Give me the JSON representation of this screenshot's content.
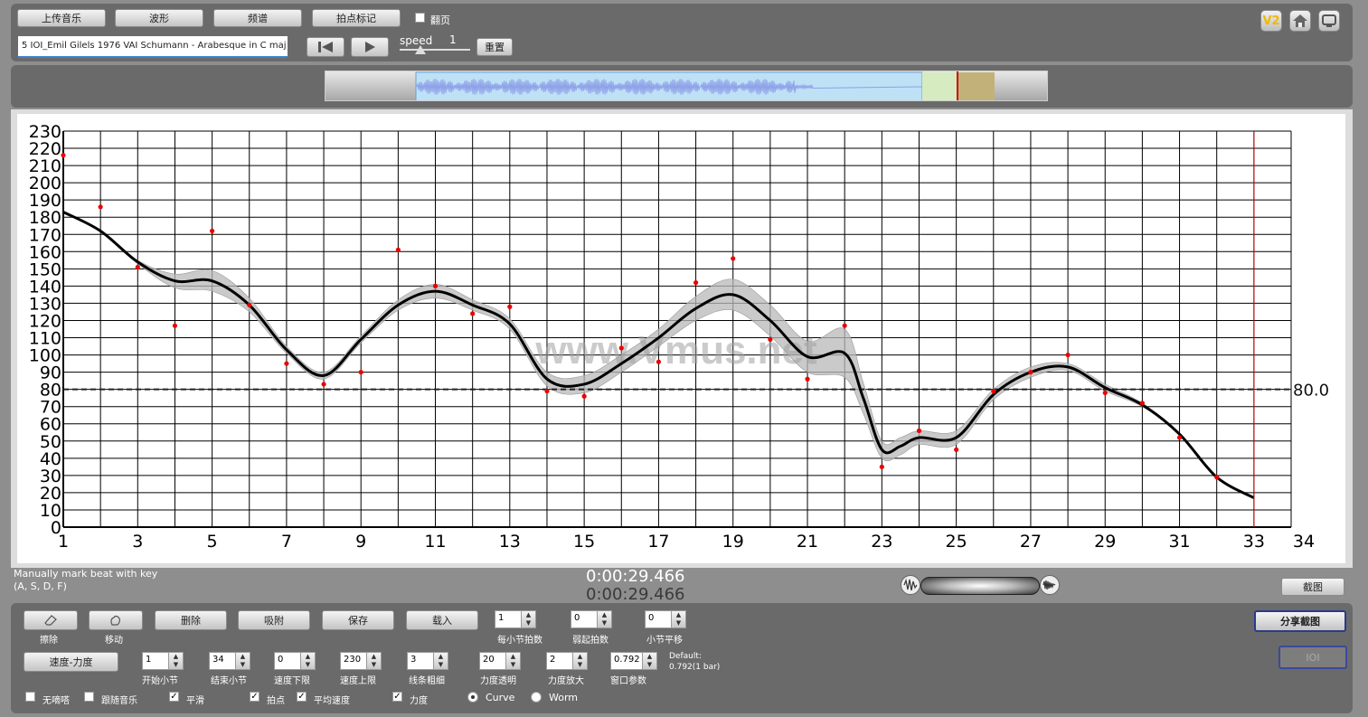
{
  "toolbar": {
    "upload_music": "上传音乐",
    "waveform": "波形",
    "spectrum": "频谱",
    "beat_mark": "拍点标记",
    "page_turn": "翻页",
    "page_turn_checked": false,
    "file_name": "5 IOI_Emil Gilels 1976 VAI Schumann - Arabesque in C maj",
    "speed_label": "speed",
    "speed_value": "1",
    "speed_level": 0.3,
    "reset": "重置"
  },
  "icons": {
    "v2": "V2",
    "home": "home-icon",
    "screen": "monitor-icon"
  },
  "hint": {
    "line1": "Manually mark beat with key",
    "line2": "(A, S, D, F)"
  },
  "time": {
    "current": "0:00:29.466",
    "total": "0:00:29.466"
  },
  "screenshot_button": "截图",
  "share_screenshot_button": "分享截图",
  "ioi_button": "IOI",
  "controls": {
    "erase": "擦除",
    "move": "移动",
    "delete": "删除",
    "snap": "吸附",
    "save": "保存",
    "load": "载入",
    "beats_per_bar": {
      "value": "1",
      "label": "每小节拍数"
    },
    "pickup_beats": {
      "value": "0",
      "label": "弱起拍数"
    },
    "bar_shift": {
      "value": "0",
      "label": "小节平移"
    },
    "tempo_dynamics": "速度-力度",
    "start_bar": {
      "value": "1",
      "label": "开始小节"
    },
    "end_bar": {
      "value": "34",
      "label": "结束小节"
    },
    "tempo_min": {
      "value": "0",
      "label": "速度下限"
    },
    "tempo_max": {
      "value": "230",
      "label": "速度上限"
    },
    "line_width": {
      "value": "3",
      "label": "线条粗细"
    },
    "dyn_transparency": {
      "value": "20",
      "label": "力度透明"
    },
    "dyn_scale": {
      "value": "2",
      "label": "力度放大"
    },
    "window_param": {
      "value": "0.792",
      "label": "窗口参数"
    },
    "default_line1": "Default:",
    "default_line2": "0.792(1 bar)"
  },
  "checkboxes": [
    {
      "label": "无嘀嗒",
      "checked": false
    },
    {
      "label": "跟随音乐",
      "checked": false
    },
    {
      "label": "平滑",
      "checked": true
    },
    {
      "label": "拍点",
      "checked": true
    },
    {
      "label": "平均速度",
      "checked": true
    },
    {
      "label": "力度",
      "checked": true
    }
  ],
  "radios": [
    {
      "label": "Curve",
      "selected": true
    },
    {
      "label": "Worm",
      "selected": false
    }
  ],
  "watermark": "www.Vmus.net",
  "colors": {
    "accent": "#cc0000",
    "points": "#ee0000",
    "band": "#bdbdbd",
    "selection": "#bfe1f6",
    "wave": "#8ea0e8"
  },
  "chart_data": {
    "type": "line",
    "ylim": [
      0,
      230
    ],
    "xlim": [
      1,
      34
    ],
    "y_ticks": [
      0,
      10,
      20,
      30,
      40,
      50,
      60,
      70,
      80,
      90,
      100,
      110,
      120,
      130,
      140,
      150,
      160,
      170,
      180,
      190,
      200,
      210,
      220,
      230
    ],
    "x_tick_labels": [
      1,
      3,
      5,
      7,
      9,
      11,
      13,
      15,
      17,
      19,
      21,
      23,
      25,
      27,
      29,
      31,
      33,
      34
    ],
    "average_tempo": 80.0,
    "average_label": "80.0",
    "cursor_x": 33,
    "beat_points": [
      {
        "x": 1,
        "y": 216
      },
      {
        "x": 2,
        "y": 186
      },
      {
        "x": 3,
        "y": 151
      },
      {
        "x": 4,
        "y": 117
      },
      {
        "x": 5,
        "y": 172
      },
      {
        "x": 6,
        "y": 129
      },
      {
        "x": 7,
        "y": 95
      },
      {
        "x": 8,
        "y": 83
      },
      {
        "x": 9,
        "y": 90
      },
      {
        "x": 10,
        "y": 161
      },
      {
        "x": 11,
        "y": 140
      },
      {
        "x": 12,
        "y": 124
      },
      {
        "x": 13,
        "y": 128
      },
      {
        "x": 14,
        "y": 79
      },
      {
        "x": 15,
        "y": 76
      },
      {
        "x": 16,
        "y": 104
      },
      {
        "x": 17,
        "y": 96
      },
      {
        "x": 18,
        "y": 142
      },
      {
        "x": 19,
        "y": 156
      },
      {
        "x": 20,
        "y": 109
      },
      {
        "x": 21,
        "y": 86
      },
      {
        "x": 22,
        "y": 117
      },
      {
        "x": 23,
        "y": 35
      },
      {
        "x": 24,
        "y": 56
      },
      {
        "x": 25,
        "y": 45
      },
      {
        "x": 26,
        "y": 79
      },
      {
        "x": 27,
        "y": 90
      },
      {
        "x": 28,
        "y": 100
      },
      {
        "x": 29,
        "y": 78
      },
      {
        "x": 30,
        "y": 72
      },
      {
        "x": 31,
        "y": 52
      },
      {
        "x": 32,
        "y": 29
      }
    ],
    "smooth_curve": [
      {
        "x": 1,
        "y": 183
      },
      {
        "x": 2,
        "y": 172
      },
      {
        "x": 3,
        "y": 154
      },
      {
        "x": 4,
        "y": 143
      },
      {
        "x": 5,
        "y": 143
      },
      {
        "x": 6,
        "y": 129
      },
      {
        "x": 7,
        "y": 103
      },
      {
        "x": 8,
        "y": 88
      },
      {
        "x": 9,
        "y": 109
      },
      {
        "x": 10,
        "y": 129
      },
      {
        "x": 11,
        "y": 137
      },
      {
        "x": 12,
        "y": 129
      },
      {
        "x": 13,
        "y": 118
      },
      {
        "x": 14,
        "y": 86
      },
      {
        "x": 15,
        "y": 83
      },
      {
        "x": 16,
        "y": 95
      },
      {
        "x": 17,
        "y": 110
      },
      {
        "x": 18,
        "y": 127
      },
      {
        "x": 19,
        "y": 135
      },
      {
        "x": 20,
        "y": 120
      },
      {
        "x": 21,
        "y": 99
      },
      {
        "x": 22,
        "y": 101
      },
      {
        "x": 22.5,
        "y": 75
      },
      {
        "x": 23,
        "y": 45
      },
      {
        "x": 23.5,
        "y": 47
      },
      {
        "x": 24,
        "y": 52
      },
      {
        "x": 25,
        "y": 52
      },
      {
        "x": 26,
        "y": 77
      },
      {
        "x": 27,
        "y": 90
      },
      {
        "x": 28,
        "y": 93
      },
      {
        "x": 29,
        "y": 81
      },
      {
        "x": 30,
        "y": 71
      },
      {
        "x": 31,
        "y": 54
      },
      {
        "x": 32,
        "y": 29
      },
      {
        "x": 33,
        "y": 17
      }
    ],
    "band_half_width": [
      0,
      0,
      1,
      4,
      6,
      4,
      2,
      2,
      2,
      3,
      4,
      3,
      3,
      4,
      5,
      5,
      5,
      7,
      9,
      9,
      9,
      14,
      9,
      5,
      5,
      4,
      4,
      3,
      3,
      2,
      2,
      1,
      0,
      0,
      0
    ]
  }
}
